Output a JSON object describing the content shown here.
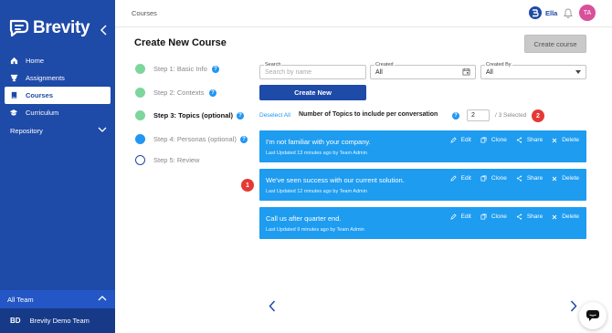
{
  "sidebar": {
    "logo_text": "Brevity",
    "items": [
      {
        "label": "Home",
        "icon": "home-icon"
      },
      {
        "label": "Assignments",
        "icon": "trophy-icon"
      },
      {
        "label": "Courses",
        "icon": "book-icon",
        "active": true
      },
      {
        "label": "Curriculum",
        "icon": "graduation-cap-icon"
      }
    ],
    "repository_label": "Repository",
    "team_label": "All Team",
    "team_initials": "BD",
    "team_name": "Brevity Demo Team"
  },
  "topbar": {
    "breadcrumb": "Courses",
    "user_name": "Ella",
    "avatar_initials": "TA"
  },
  "main": {
    "title": "Create New Course",
    "create_button": "Create course",
    "steps": [
      {
        "label": "Step 1: Basic Info",
        "state": "done"
      },
      {
        "label": "Step 2: Contexts",
        "state": "done"
      },
      {
        "label": "Step 3: Topics (optional)",
        "state": "current"
      },
      {
        "label": "Step 4: Personas (optional)",
        "state": "upcoming"
      },
      {
        "label": "Step 5: Review",
        "state": "empty"
      }
    ],
    "filters": {
      "search_label": "Search",
      "search_placeholder": "Search by name",
      "created_label": "Created",
      "created_value": "All",
      "created_by_label": "Created By",
      "created_by_value": "All"
    },
    "create_new_button": "Create New",
    "deselect_all": "Deselect All",
    "num_topics_label": "Number of Topics to include per conversation",
    "num_topics_value": "2",
    "selected_text": "/ 3 Selected",
    "badges": [
      "1",
      "2"
    ],
    "cards": [
      {
        "title": "I'm not familiar with your company.",
        "meta": "Last Updated 13 minutes ago by Team Admin"
      },
      {
        "title": "We've seen success with our current solution.",
        "meta": "Last Updated 12 minutes ago by Team Admin"
      },
      {
        "title": "Call us after quarter end.",
        "meta": "Last Updated 9 minutes ago by Team Admin"
      }
    ],
    "card_actions": {
      "edit": "Edit",
      "clone": "Clone",
      "share": "Share",
      "delete": "Delete"
    }
  },
  "colors": {
    "sidebar": "#1e4aa8",
    "card": "#1e9cf0",
    "step_done": "#7ed69c",
    "badge": "#e53935",
    "avatar": "#d8509a"
  }
}
